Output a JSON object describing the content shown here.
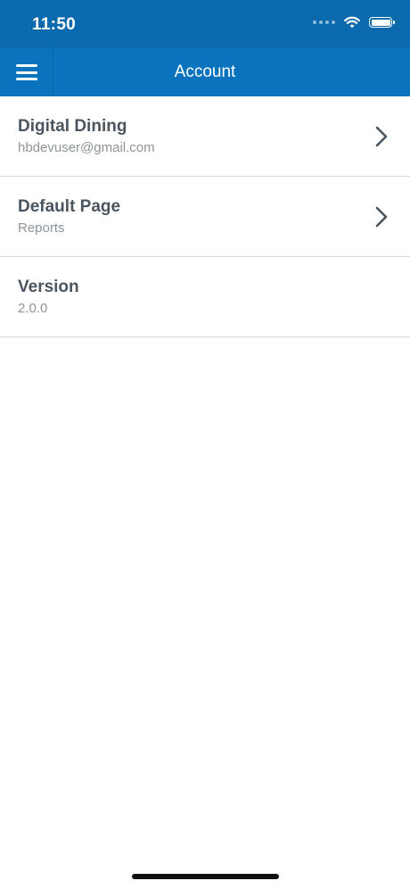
{
  "status_bar": {
    "time": "11:50",
    "icons": [
      "signal-dots-icon",
      "wifi-icon",
      "battery-icon"
    ],
    "battery_level": 1.0
  },
  "nav": {
    "title": "Account",
    "menu_icon": "hamburger-menu-icon"
  },
  "rows": [
    {
      "title": "Digital Dining",
      "subtitle": "hbdevuser@gmail.com",
      "has_chevron": true
    },
    {
      "title": "Default Page",
      "subtitle": "Reports",
      "has_chevron": true
    },
    {
      "title": "Version",
      "subtitle": "2.0.0",
      "has_chevron": false
    }
  ],
  "colors": {
    "status_bar_bg": "#0a6aad",
    "nav_bar_bg": "#0a73bd",
    "title_text": "#4a5560",
    "subtitle_text": "#8c949a",
    "divider": "#d8d8d8"
  }
}
